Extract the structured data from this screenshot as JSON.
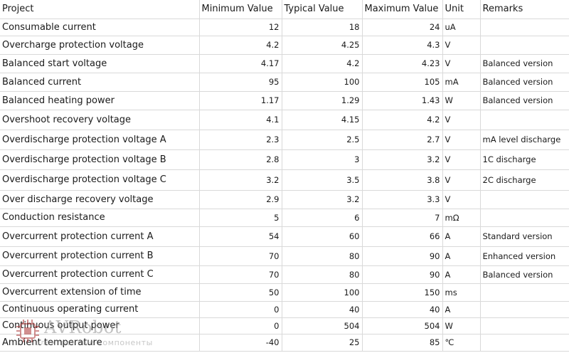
{
  "table": {
    "headers": [
      "Project",
      "Minimum Value",
      "Typical Value",
      "Maximum Value",
      "Unit",
      "Remarks"
    ],
    "rows": [
      [
        "Consumable current",
        "12",
        "18",
        "24",
        "uA",
        ""
      ],
      [
        "Overcharge protection voltage",
        "4.2",
        "4.25",
        "4.3",
        "V",
        ""
      ],
      [
        "Balanced start voltage",
        "4.17",
        "4.2",
        "4.23",
        "V",
        "Balanced version"
      ],
      [
        "Balanced current",
        "95",
        "100",
        "105",
        "mA",
        "Balanced version"
      ],
      [
        "Balanced heating power",
        "1.17",
        "1.29",
        "1.43",
        "W",
        "Balanced version"
      ],
      [
        "Overshoot recovery voltage",
        "4.1",
        "4.15",
        "4.2",
        "V",
        ""
      ],
      [
        "Overdischarge protection voltage A",
        "2.3",
        "2.5",
        "2.7",
        "V",
        "mA level discharge"
      ],
      [
        "Overdischarge protection voltage B",
        "2.8",
        "3",
        "3.2",
        "V",
        "1C discharge"
      ],
      [
        "Overdischarge protection voltage C",
        "3.2",
        "3.5",
        "3.8",
        "V",
        "2C discharge"
      ],
      [
        "Over discharge recovery voltage",
        "2.9",
        "3.2",
        "3.3",
        "V",
        ""
      ],
      [
        "Conduction resistance",
        "5",
        "6",
        "7",
        "mΩ",
        ""
      ],
      [
        "Overcurrent protection current A",
        "54",
        "60",
        "66",
        "A",
        "Standard version"
      ],
      [
        "Overcurrent protection current B",
        "70",
        "80",
        "90",
        "A",
        "Enhanced version"
      ],
      [
        "Overcurrent protection current C",
        "70",
        "80",
        "90",
        "A",
        "Balanced version"
      ],
      [
        "Overcurrent extension of time",
        "50",
        "100",
        "150",
        "ms",
        ""
      ],
      [
        "Continuous operating current",
        "0",
        "40",
        "40",
        "A",
        ""
      ],
      [
        "Continuous output power",
        "0",
        "504",
        "504",
        "W",
        ""
      ],
      [
        "Ambient temperature",
        "-40",
        "25",
        "85",
        "℃",
        ""
      ]
    ]
  },
  "watermark": {
    "brand": "AVRobot",
    "tagline": "электронные компоненты",
    "color": "#8f8f8f"
  }
}
